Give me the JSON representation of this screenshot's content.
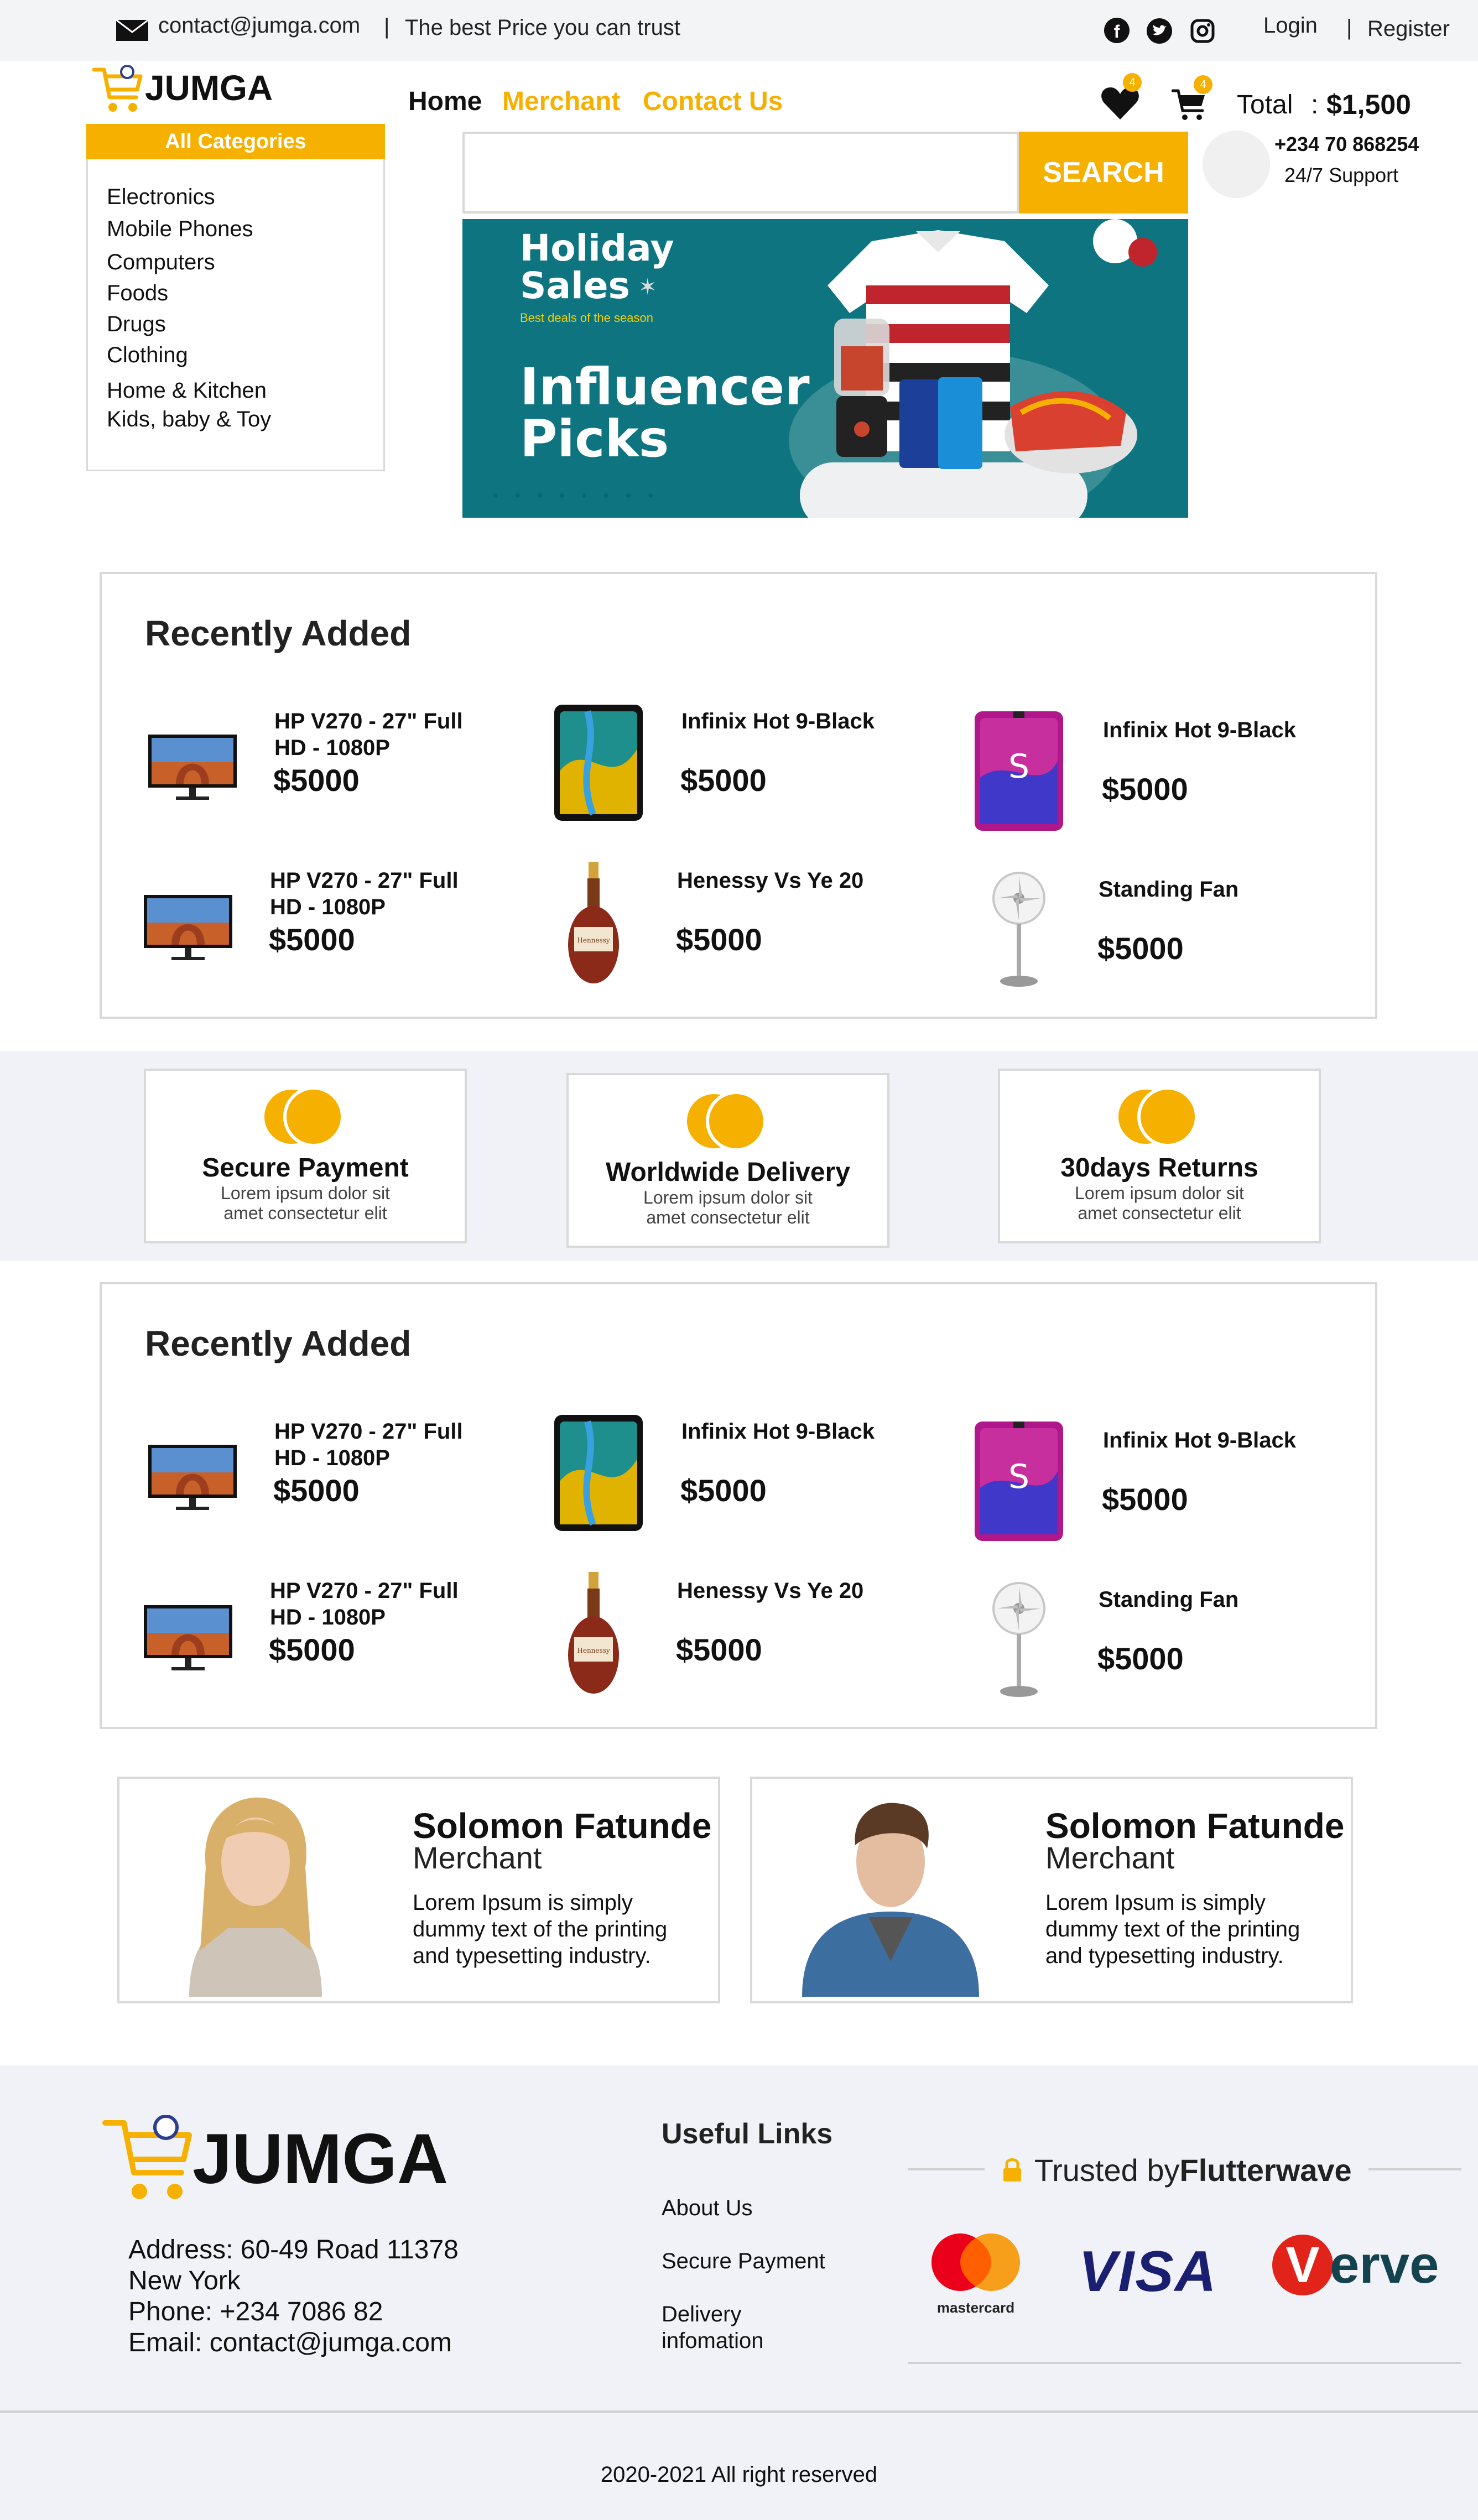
{
  "topbar": {
    "email": "contact@jumga.com",
    "separator": "|",
    "tagline": "The best Price you can trust",
    "login": "Login",
    "separator2": "|",
    "register": "Register",
    "socials": [
      "facebook-icon",
      "twitter-icon",
      "instagram-icon"
    ]
  },
  "header": {
    "logo": "JUMGA",
    "nav": [
      "Home",
      "Merchant",
      "Contact Us"
    ],
    "wishlist_count": "4",
    "cart_count": "4",
    "total_label": "Total",
    "total_colon": ":",
    "total_value": "$1,500",
    "phone": "+234 70 868254",
    "support": "24/7 Support"
  },
  "categories": {
    "title": "All  Categories",
    "items": [
      "Electronics",
      "Mobile Phones",
      "Computers",
      "Foods",
      "Drugs",
      "Clothing",
      "Home & Kitchen",
      "Kids, baby & Toy"
    ]
  },
  "search": {
    "placeholder": "",
    "button": "SEARCH"
  },
  "banner": {
    "line1": "Holiday",
    "line2": "Sales",
    "sub": "Best deals of the season",
    "line3": "Influencer",
    "line4": "Picks"
  },
  "recent1": {
    "title": "Recently Added",
    "products": [
      {
        "name1": "HP V270 - 27\" Full",
        "name2": "HD - 1080P",
        "price": "$5000"
      },
      {
        "name1": "Infinix Hot 9-Black",
        "name2": "",
        "price": "$5000"
      },
      {
        "name1": "Infinix Hot 9-Black",
        "name2": "",
        "price": "$5000"
      },
      {
        "name1": "HP V270 - 27\" Full",
        "name2": "HD - 1080P",
        "price": "$5000"
      },
      {
        "name1": "Henessy  Vs Ye 20",
        "name2": "",
        "price": "$5000"
      },
      {
        "name1": "Standing Fan",
        "name2": "",
        "price": "$5000"
      }
    ]
  },
  "features": [
    {
      "title": "Secure Payment",
      "desc1": "Lorem ipsum dolor sit",
      "desc2": "amet consectetur elit"
    },
    {
      "title": "Worldwide Delivery",
      "desc1": "Lorem ipsum dolor sit",
      "desc2": "amet consectetur elit"
    },
    {
      "title": "30days Returns",
      "desc1": "Lorem ipsum dolor sit",
      "desc2": "amet consectetur elit"
    }
  ],
  "recent2": {
    "title": "Recently Added",
    "products": [
      {
        "name1": "HP V270 - 27\" Full",
        "name2": "HD - 1080P",
        "price": "$5000"
      },
      {
        "name1": "Infinix Hot 9-Black",
        "name2": "",
        "price": "$5000"
      },
      {
        "name1": "Infinix Hot 9-Black",
        "name2": "",
        "price": "$5000"
      },
      {
        "name1": "HP V270 - 27\" Full",
        "name2": "HD - 1080P",
        "price": "$5000"
      },
      {
        "name1": "Henessy  Vs Ye 20",
        "name2": "",
        "price": "$5000"
      },
      {
        "name1": "Standing Fan",
        "name2": "",
        "price": "$5000"
      }
    ]
  },
  "merchants": [
    {
      "name": "Solomon Fatunde",
      "role": "Merchant",
      "desc": "Lorem Ipsum is simply dummy text of the printing and typesetting industry."
    },
    {
      "name": "Solomon Fatunde",
      "role": "Merchant",
      "desc": "Lorem Ipsum is simply dummy text of the printing and typesetting industry."
    }
  ],
  "footer": {
    "logo": "JUMGA",
    "address1": "Address: 60-49 Road 11378",
    "address2": "New York",
    "phone": "Phone: +234 7086 82",
    "email": "Email: contact@jumga.com",
    "links_title": "Useful Links",
    "links": [
      "About Us",
      "Secure Payment",
      "Delivery",
      "infomation"
    ],
    "trusted_prefix": "Trusted by ",
    "trusted_brand": "Flutterwave",
    "cards": [
      "mastercard",
      "VISA",
      "erve"
    ],
    "copyright": "2020-2021 All right reserved"
  },
  "colors": {
    "accent": "#f5b000",
    "banner": "#0e7580",
    "band": "#f1f2f7"
  }
}
